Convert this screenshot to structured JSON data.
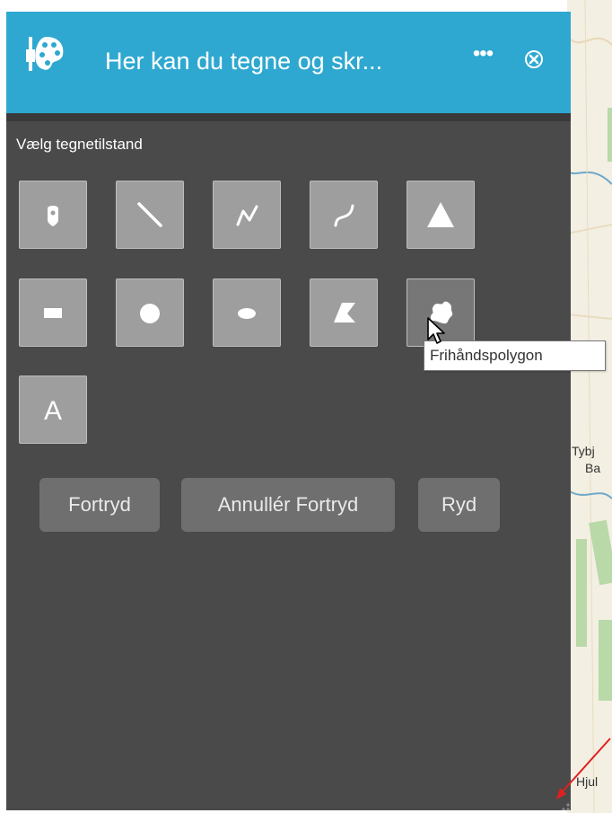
{
  "widget": {
    "title": "Her kan du tegne og skr...",
    "more_label": "•••",
    "section_label": "Vælg tegnetilstand",
    "tools": [
      {
        "name": "tool-point",
        "icon": "point-marker-icon"
      },
      {
        "name": "tool-line",
        "icon": "line-icon"
      },
      {
        "name": "tool-polyline",
        "icon": "polyline-icon"
      },
      {
        "name": "tool-freehand-line",
        "icon": "freehand-line-icon"
      },
      {
        "name": "tool-triangle",
        "icon": "triangle-icon"
      },
      {
        "name": "tool-rectangle",
        "icon": "rectangle-icon"
      },
      {
        "name": "tool-circle",
        "icon": "circle-icon"
      },
      {
        "name": "tool-ellipse",
        "icon": "ellipse-icon"
      },
      {
        "name": "tool-polygon",
        "icon": "polygon-icon"
      },
      {
        "name": "tool-freehand-polygon",
        "icon": "freehand-polygon-icon"
      },
      {
        "name": "tool-text",
        "icon": "text-icon",
        "label": "A"
      }
    ],
    "tooltip": "Frihåndspolygon",
    "buttons": {
      "undo": "Fortryd",
      "redo": "Annullér Fortryd",
      "clear": "Ryd"
    }
  },
  "map": {
    "labels": [
      "Tybj",
      "Ba",
      "Hjul"
    ]
  },
  "colors": {
    "header": "#2ea8d0",
    "panel": "#4a4a4a",
    "tool": "#9e9e9e",
    "button": "#6f6f6f",
    "annotation_arrow": "#e02020"
  }
}
